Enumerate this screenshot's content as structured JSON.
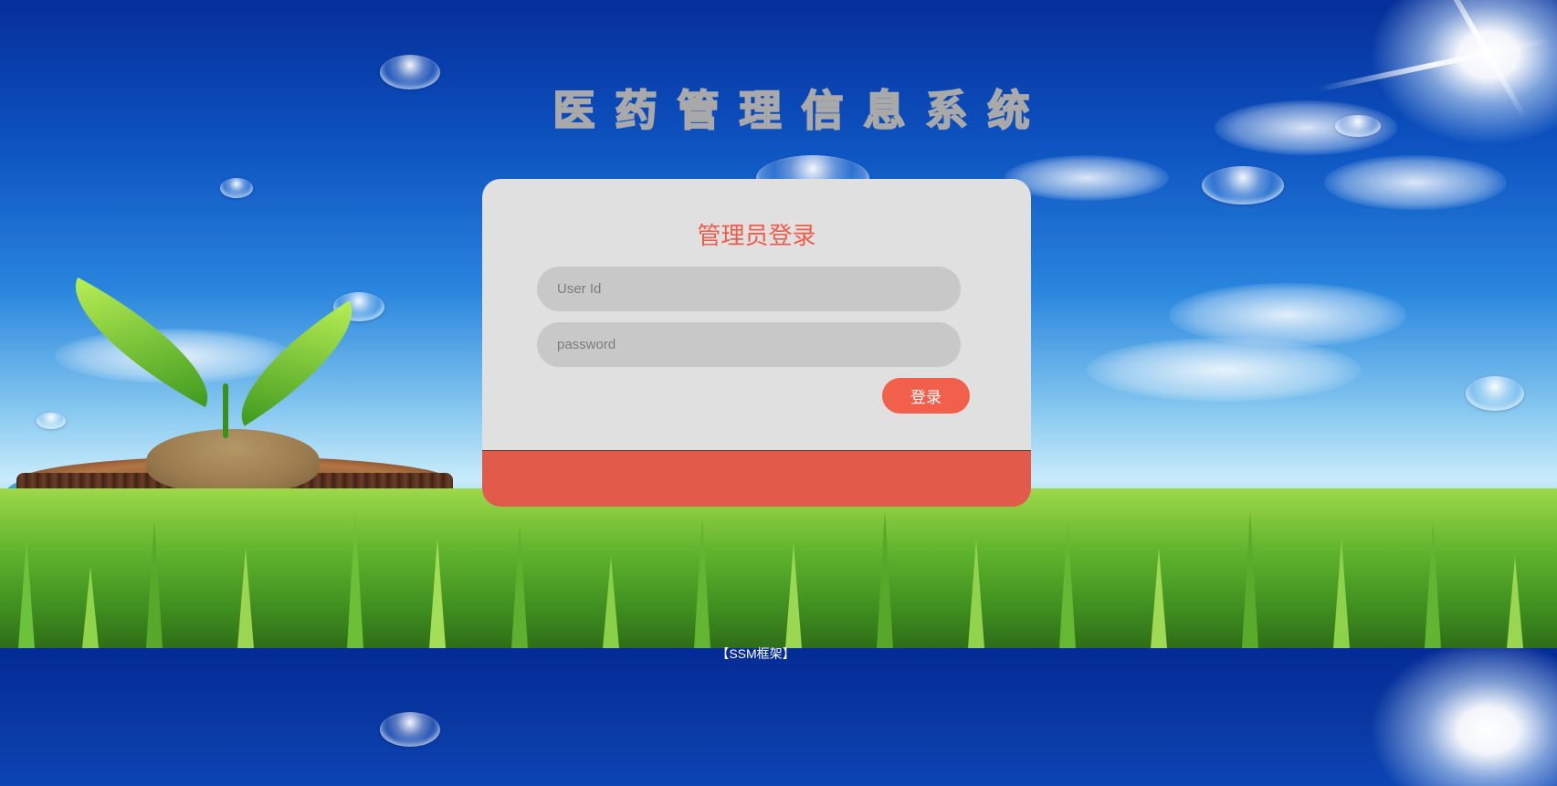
{
  "app": {
    "title": "医药管理信息系统"
  },
  "login": {
    "heading": "管理员登录",
    "user_id_placeholder": "User Id",
    "user_id_value": "",
    "password_placeholder": "password",
    "password_value": "",
    "submit_label": "登录"
  },
  "footer": {
    "framework_label": "【SSM框架】"
  },
  "colors": {
    "accent": "#f05b4a",
    "card_bg": "#e0e0e0",
    "card_footer": "#e15a4a",
    "input_bg": "#c8c8c8"
  },
  "icons": {
    "background": "sky-grass-scene"
  }
}
